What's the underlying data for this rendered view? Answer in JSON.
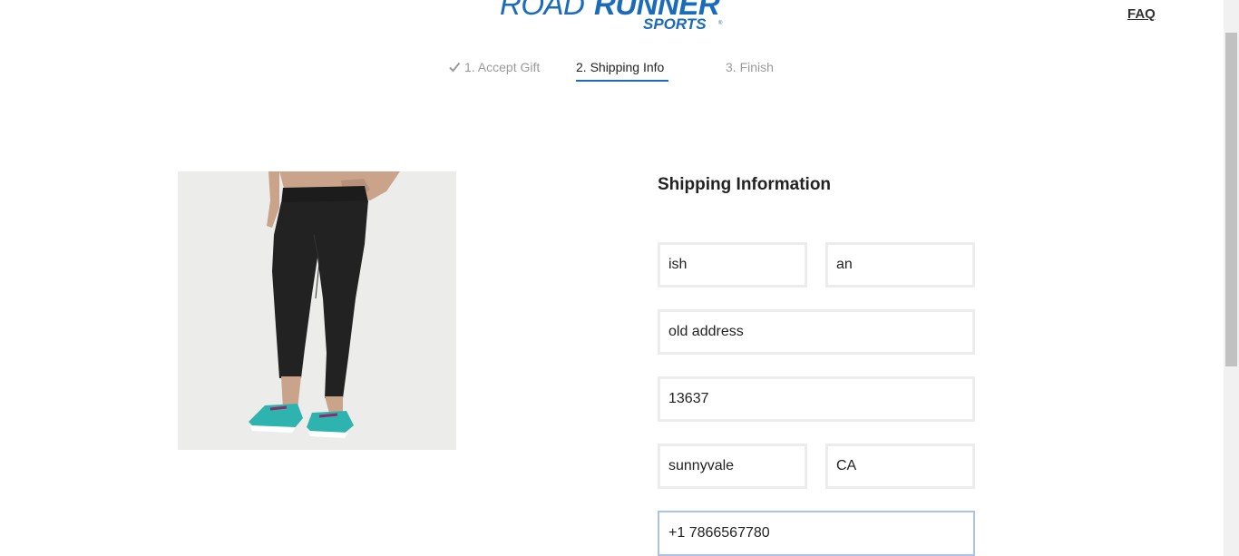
{
  "header": {
    "logo_road": "ROAD",
    "logo_runner": "RUNNER",
    "logo_sports": "SPORTS",
    "logo_reg": "®",
    "faq_label": "FAQ"
  },
  "steps": [
    {
      "label": "1. Accept Gift",
      "state": "completed",
      "icon": "checkmark-icon"
    },
    {
      "label": "2. Shipping Info",
      "state": "active"
    },
    {
      "label": "3. Finish",
      "state": "upcoming"
    }
  ],
  "product": {
    "image": "product-image-black-leggings-teal-shoes"
  },
  "form": {
    "title": "Shipping Information",
    "first_name": "ish",
    "last_name": "an",
    "address": "old address",
    "zip": "13637",
    "city": "sunnyvale",
    "state": "CA",
    "phone": "+1 7866567780"
  },
  "colors": {
    "brand_blue": "#1a6bb8",
    "field_border": "#ececec",
    "focus_border": "#a8c0f2"
  }
}
